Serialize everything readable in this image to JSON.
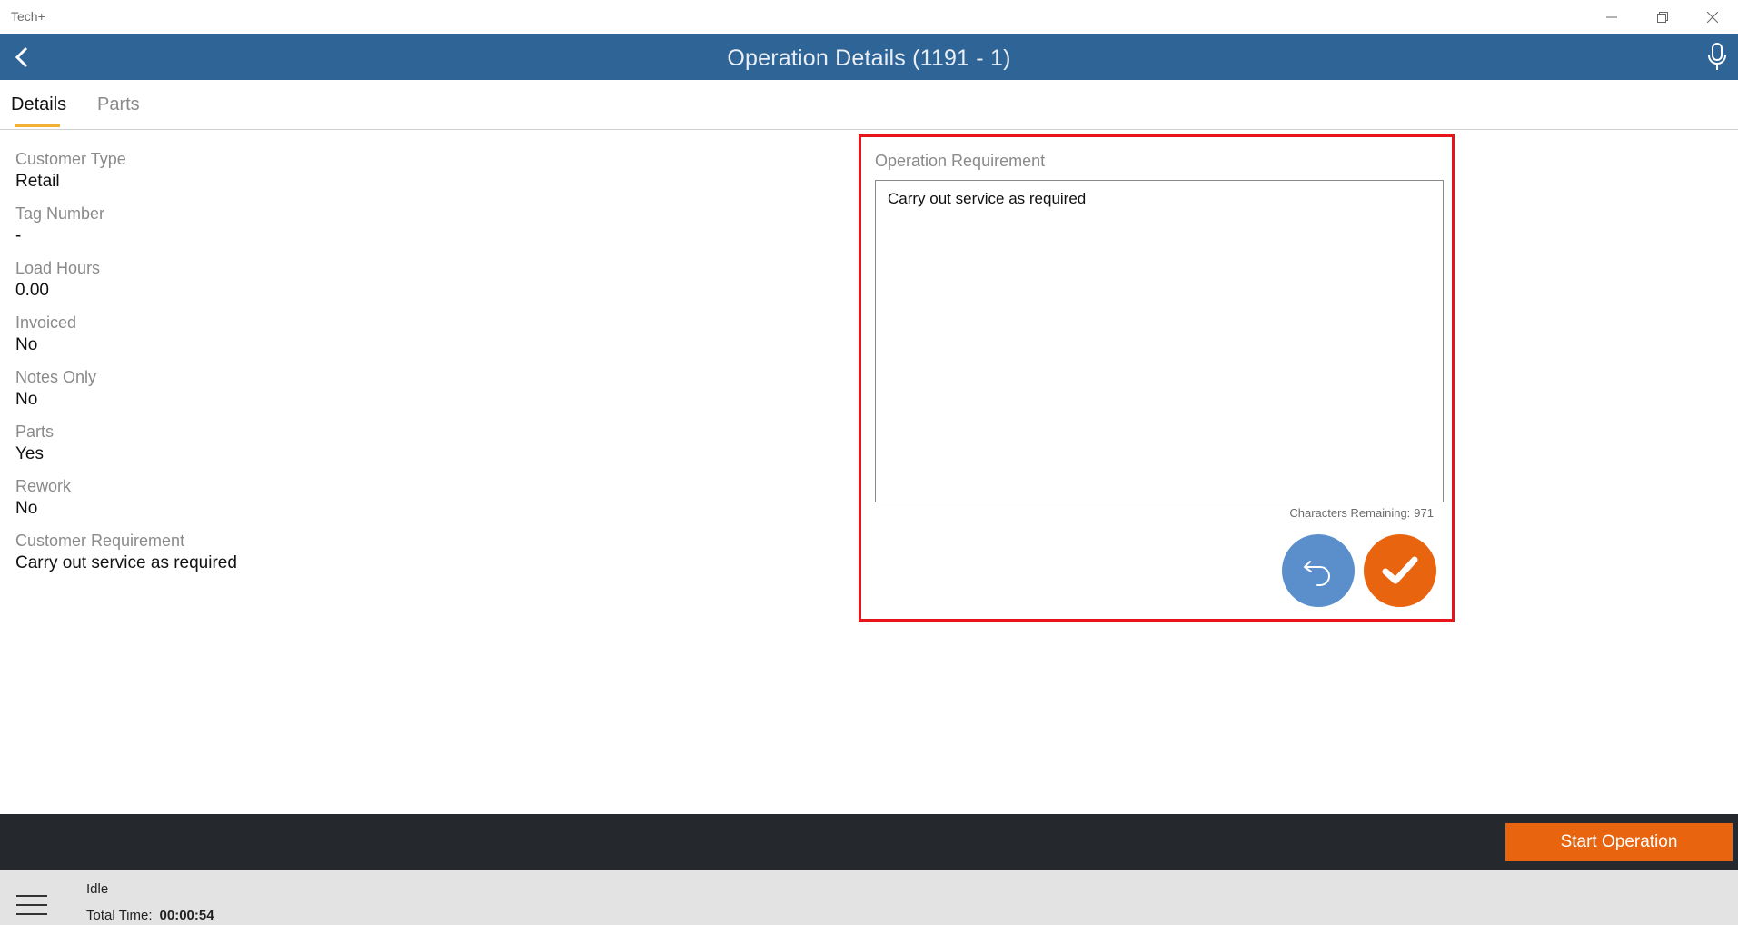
{
  "app": {
    "title": "Tech+"
  },
  "header": {
    "title": "Operation Details (1191 - 1)"
  },
  "tabs": [
    {
      "label": "Details",
      "active": true
    },
    {
      "label": "Parts",
      "active": false
    }
  ],
  "details": {
    "fields": [
      {
        "label": "Customer Type",
        "value": "Retail"
      },
      {
        "label": "Tag Number",
        "value": "-"
      },
      {
        "label": "Load Hours",
        "value": "0.00"
      },
      {
        "label": "Invoiced",
        "value": "No"
      },
      {
        "label": "Notes Only",
        "value": "No"
      },
      {
        "label": "Parts",
        "value": "Yes"
      },
      {
        "label": "Rework",
        "value": "No"
      },
      {
        "label": "Customer Requirement",
        "value": "Carry out service as required"
      }
    ]
  },
  "operation_requirement": {
    "label": "Operation Requirement",
    "value": "Carry out service as required",
    "chars_label": "Characters Remaining:",
    "chars_remaining": "971",
    "undo_icon": "undo-icon",
    "confirm_icon": "checkmark-icon"
  },
  "actions": {
    "start_label": "Start Operation"
  },
  "status": {
    "state": "Idle",
    "total_time_label": "Total Time:",
    "total_time_value": "00:00:54"
  },
  "colors": {
    "header": "#2f6496",
    "accent_orange": "#e8640f",
    "undo_blue": "#5b8fcc",
    "highlight_red": "#e8141c",
    "tab_underline": "#f2b035"
  }
}
